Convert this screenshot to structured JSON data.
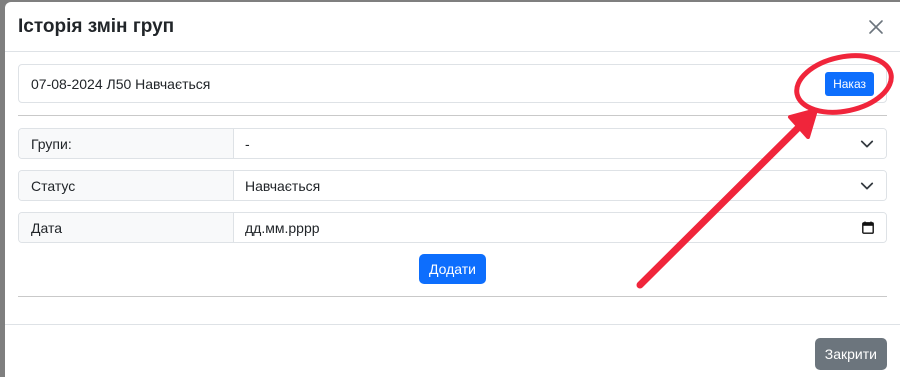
{
  "modal": {
    "title": "Історія змін груп",
    "close_icon": "close-icon"
  },
  "history": {
    "entry_text": "07-08-2024 Л50 Навчається",
    "order_button_label": "Наказ"
  },
  "form": {
    "groups": {
      "label": "Групи:",
      "value": "-"
    },
    "status": {
      "label": "Статус",
      "value": "Навчається"
    },
    "date": {
      "label": "Дата",
      "placeholder": "дд.мм.рррр"
    },
    "add_button_label": "Додати"
  },
  "footer": {
    "close_button_label": "Закрити"
  },
  "annotation": {
    "color": "#f0253b",
    "shapes": [
      "circle",
      "arrow"
    ]
  }
}
